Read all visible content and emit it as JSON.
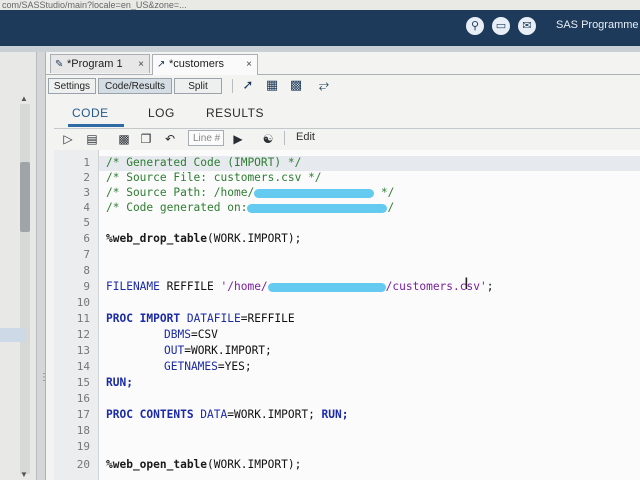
{
  "browser": {
    "url": "com/SASStudio/main?locale=en_US&zone=..."
  },
  "appbar": {
    "user_label": "SAS Programme",
    "icons": [
      "search-icon",
      "window-icon",
      "mail-icon"
    ]
  },
  "tabs": [
    {
      "label": "*Program 1",
      "close": "×",
      "icon": "program-icon"
    },
    {
      "label": "*customers",
      "close": "×",
      "icon": "import-icon"
    }
  ],
  "view_modes": {
    "settings": "Settings",
    "code_results": "Code/Results",
    "split": "Split"
  },
  "inner_tabs": {
    "code": "CODE",
    "log": "LOG",
    "results": "RESULTS"
  },
  "editor_toolbar": {
    "line_placeholder": "Line #",
    "edit_label": "Edit"
  },
  "code": {
    "line_numbers": [
      "1",
      "2",
      "3",
      "4",
      "5",
      "6",
      "7",
      "8",
      "9",
      "10",
      "11",
      "12",
      "13",
      "14",
      "15",
      "16",
      "17",
      "18",
      "19",
      "20"
    ],
    "l1": "/* Generated Code (IMPORT) */",
    "l2": "/* Source File: customers.csv */",
    "l3a": "/* Source Path: /home/",
    "l3b": " */",
    "l4a": "/* Code generated on:",
    "l4b": "/",
    "l6a": "%web_drop_table",
    "l6b": "(WORK.IMPORT);",
    "l9a": "FILENAME",
    "l9b": " REFFILE ",
    "l9c": "'/home/",
    "l9d": "/customers.csv'",
    "l9e": ";",
    "l11a": "PROC IMPORT",
    "l11b": " DATAFILE",
    "l11c": "=REFFILE",
    "l12a": "DBMS",
    "l12b": "=CSV",
    "l13a": "OUT",
    "l13b": "=WORK.IMPORT;",
    "l14a": "GETNAMES",
    "l14b": "=YES;",
    "l15": "RUN;",
    "l17a": "PROC CONTENTS",
    "l17b": " DATA",
    "l17c": "=WORK.IMPORT; ",
    "l17d": "RUN;",
    "l20a": "%web_open_table",
    "l20b": "(WORK.IMPORT);"
  },
  "colors": {
    "appbar": "#1d3a5a",
    "comment": "#2e7d32",
    "keyword": "#1b2aa6",
    "string": "#7a1fa2",
    "redaction": "#58c6ee",
    "active_tab_text": "#24598c"
  }
}
